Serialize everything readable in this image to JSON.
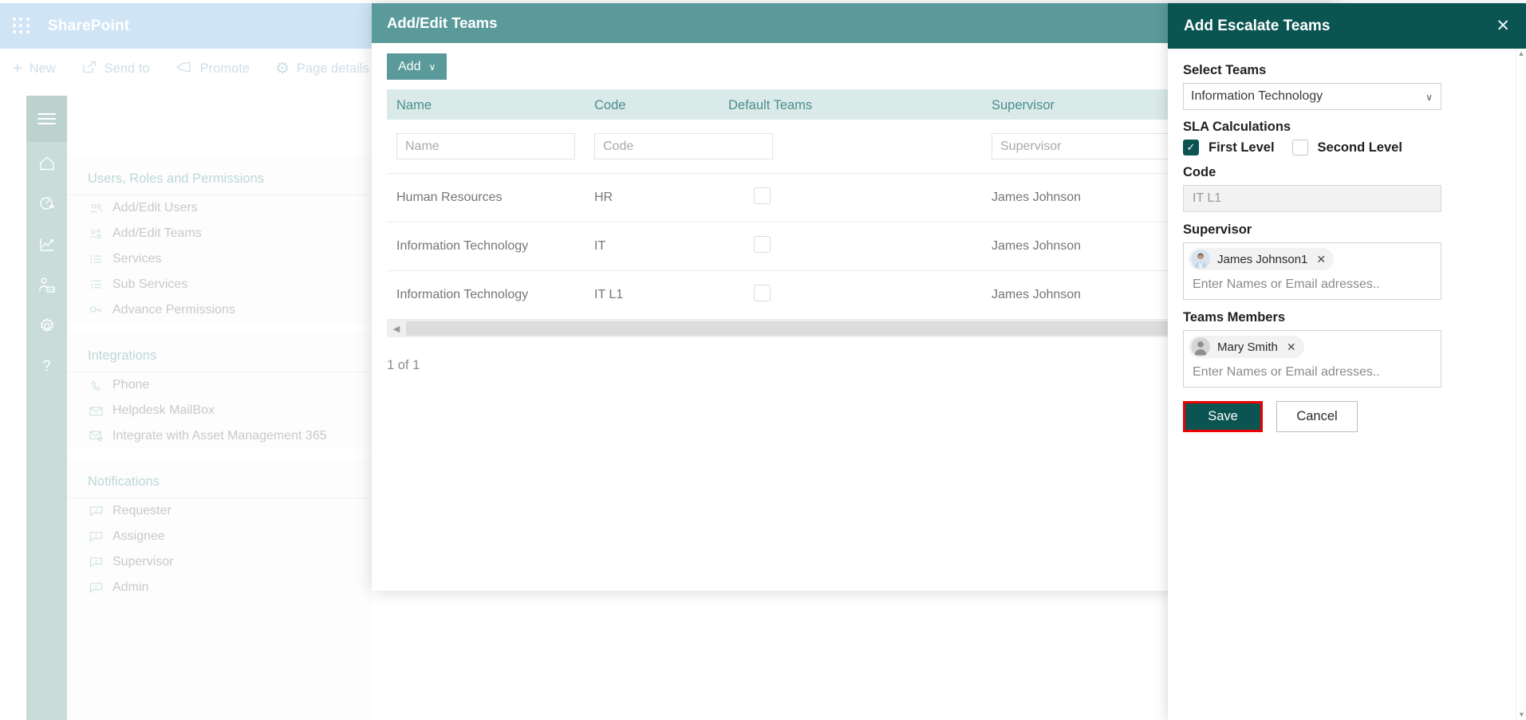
{
  "sharepoint": {
    "brand": "SharePoint",
    "waffle_icon": "app-launcher-icon",
    "commands": [
      {
        "label": "New",
        "icon": "plus-icon",
        "glyph": "+"
      },
      {
        "label": "Send to",
        "icon": "share-icon",
        "glyph": "↗"
      },
      {
        "label": "Promote",
        "icon": "megaphone-icon",
        "glyph": "◁"
      },
      {
        "label": "Page details",
        "icon": "gear-icon",
        "glyph": "⚙"
      }
    ]
  },
  "rail": {
    "menu_icon": "hamburger-icon",
    "icons": [
      {
        "name": "home-icon"
      },
      {
        "name": "dashboard-icon"
      },
      {
        "name": "analytics-icon"
      },
      {
        "name": "user-management-icon"
      },
      {
        "name": "settings-gear-icon"
      },
      {
        "name": "help-question-icon",
        "glyph": "?"
      }
    ]
  },
  "settings_menu": {
    "sections": [
      {
        "title": "Users, Roles and Permissions",
        "items": [
          {
            "label": "Add/Edit Users",
            "icon": "users-icon"
          },
          {
            "label": "Add/Edit Teams",
            "icon": "team-icon"
          },
          {
            "label": "Services",
            "icon": "list-icon"
          },
          {
            "label": "Sub Services",
            "icon": "sublist-icon"
          },
          {
            "label": "Advance Permissions",
            "icon": "key-icon"
          }
        ]
      },
      {
        "title": "Integrations",
        "items": [
          {
            "label": "Phone",
            "icon": "phone-icon"
          },
          {
            "label": "Helpdesk MailBox",
            "icon": "envelope-icon"
          },
          {
            "label": "Integrate with Asset Management 365",
            "icon": "envelope-gear-icon"
          }
        ]
      },
      {
        "title": "Notifications",
        "items": [
          {
            "label": "Requester",
            "icon": "notification-icon"
          },
          {
            "label": "Assignee",
            "icon": "notification-icon"
          },
          {
            "label": "Supervisor",
            "icon": "notification-icon"
          },
          {
            "label": "Admin",
            "icon": "notification-icon"
          }
        ]
      }
    ]
  },
  "teams_modal": {
    "title": "Add/Edit Teams",
    "add_button": "Add",
    "add_chevron": "∨",
    "columns": [
      "Name",
      "Code",
      "Default Teams",
      "Supervisor"
    ],
    "filters": [
      {
        "placeholder": "Name"
      },
      {
        "placeholder": "Code"
      },
      {
        "placeholder": "Supervisor"
      }
    ],
    "rows": [
      {
        "name": "Human Resources",
        "code": "HR",
        "default_team": false,
        "supervisor": "James Johnson"
      },
      {
        "name": "Information Technology",
        "code": "IT",
        "default_team": false,
        "supervisor": "James Johnson"
      },
      {
        "name": "Information Technology",
        "code": "IT L1",
        "default_team": false,
        "supervisor": "James Johnson"
      }
    ],
    "scroll_left_arrow": "◀",
    "page_info": "1 of 1"
  },
  "escalate_panel": {
    "title": "Add Escalate Teams",
    "close_icon": "close-icon",
    "close_glyph": "✕",
    "select_teams": {
      "label": "Select Teams",
      "value": "Information Technology",
      "chevron": "∨"
    },
    "sla": {
      "label": "SLA Calculations",
      "first_level": {
        "label": "First Level",
        "checked": true,
        "check_glyph": "✓"
      },
      "second_level": {
        "label": "Second Level",
        "checked": false
      }
    },
    "code": {
      "label": "Code",
      "value": "IT L1"
    },
    "supervisor": {
      "label": "Supervisor",
      "pills": [
        {
          "name": "James Johnson1",
          "avatar": "photo-avatar",
          "remove_glyph": "✕"
        }
      ],
      "placeholder": "Enter Names or Email adresses.."
    },
    "team_members": {
      "label": "Teams Members",
      "pills": [
        {
          "name": "Mary Smith",
          "avatar": "generic-avatar",
          "remove_glyph": "✕"
        }
      ],
      "placeholder": "Enter Names or Email adresses.."
    },
    "save_label": "Save",
    "cancel_label": "Cancel",
    "highlight_color": "#ef0000",
    "accent_color": "#0a5451"
  }
}
